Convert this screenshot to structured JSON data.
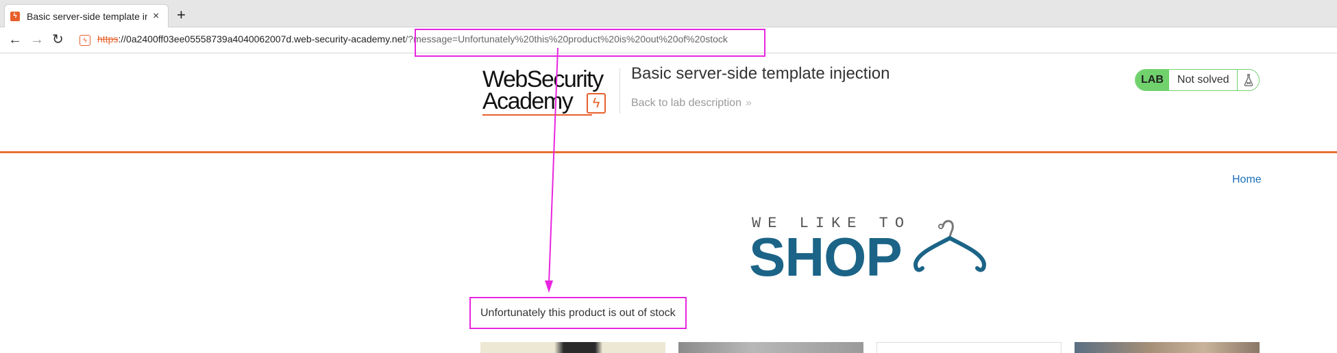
{
  "browser": {
    "tab_title": "Basic server-side template injection",
    "tab_close": "×",
    "new_tab": "+",
    "url_scheme": "https",
    "url_sep": "://",
    "url_host": "0a2400ff03ee05558739a4040062007d.web-security-academy.net",
    "url_path": "/",
    "url_query": "?message=Unfortunately%20this%20product%20is%20out%20of%20stock"
  },
  "header": {
    "logo_line1": "WebSecurity",
    "logo_line2": "Academy",
    "title": "Basic server-side template injection",
    "back_link": "Back to lab description",
    "status_badge": "LAB",
    "status_text": "Not solved"
  },
  "nav": {
    "home": "Home"
  },
  "shop_logo": {
    "small": "WE LIKE TO",
    "big": "SHOP"
  },
  "message": "Unfortunately this product is out of stock",
  "colors": {
    "accent": "#e85f2b",
    "annotation": "#e825e0",
    "status_green": "#70d16d",
    "shop_blue": "#1b6487",
    "link_blue": "#1a6fb8"
  },
  "icons": [
    "back-arrow-icon",
    "forward-arrow-icon",
    "reload-icon",
    "site-lock-icon",
    "tab-favicon",
    "flask-icon",
    "hanger-icon"
  ]
}
